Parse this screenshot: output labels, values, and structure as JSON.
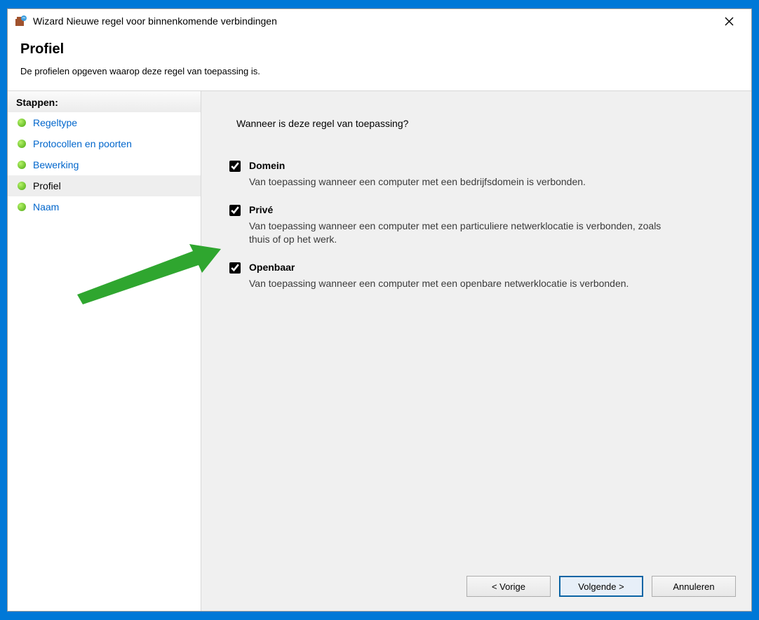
{
  "window": {
    "title": "Wizard Nieuwe regel voor binnenkomende verbindingen"
  },
  "header": {
    "title": "Profiel",
    "subtitle": "De profielen opgeven waarop deze regel van toepassing is."
  },
  "sidebar": {
    "steps_label": "Stappen:",
    "items": [
      {
        "label": "Regeltype",
        "state": "link"
      },
      {
        "label": "Protocollen en poorten",
        "state": "link"
      },
      {
        "label": "Bewerking",
        "state": "link"
      },
      {
        "label": "Profiel",
        "state": "current"
      },
      {
        "label": "Naam",
        "state": "link"
      }
    ]
  },
  "content": {
    "question": "Wanneer is deze regel van toepassing?",
    "options": [
      {
        "label": "Domein",
        "checked": true,
        "desc": "Van toepassing wanneer een computer met een bedrijfsdomein is verbonden."
      },
      {
        "label": "Privé",
        "checked": true,
        "desc": "Van toepassing wanneer een computer met een particuliere netwerklocatie is verbonden, zoals thuis of op het werk."
      },
      {
        "label": "Openbaar",
        "checked": true,
        "desc": "Van toepassing wanneer een computer met een openbare netwerklocatie is verbonden."
      }
    ]
  },
  "buttons": {
    "back": "< Vorige",
    "next": "Volgende >",
    "cancel": "Annuleren"
  }
}
